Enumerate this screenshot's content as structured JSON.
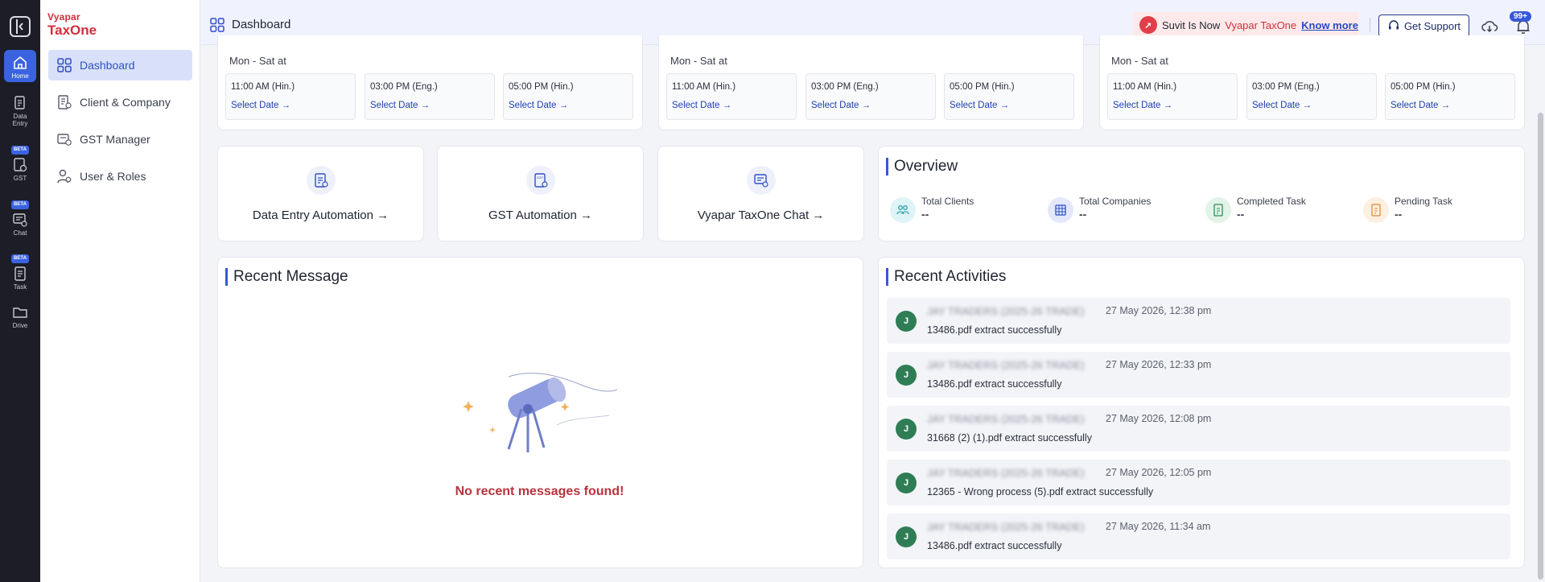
{
  "rail": {
    "items": [
      {
        "label": "Home",
        "icon": "home-icon"
      },
      {
        "label": "Data Entry",
        "icon": "data-entry-icon"
      },
      {
        "label": "GST",
        "icon": "gst-icon",
        "badge": "BETA"
      },
      {
        "label": "Chat",
        "icon": "chat-icon",
        "badge": "BETA"
      },
      {
        "label": "Task",
        "icon": "task-icon",
        "badge": "BETA"
      },
      {
        "label": "Drive",
        "icon": "folder-icon"
      }
    ]
  },
  "sidebar": {
    "logo_top": "Vyapar",
    "logo_main": "TaxOne",
    "items": [
      {
        "label": "Dashboard",
        "active": true
      },
      {
        "label": "Client & Company"
      },
      {
        "label": "GST Manager"
      },
      {
        "label": "User & Roles"
      }
    ]
  },
  "header": {
    "title": "Dashboard",
    "promo": {
      "text_a": "Suvit Is Now",
      "text_b": "Vyapar TaxOne",
      "link": "Know more"
    },
    "support_label": "Get Support",
    "notif_count": "99+"
  },
  "schedules": [
    {
      "label": "Mon - Sat at",
      "slots": [
        {
          "time": "11:00 AM (Hin.)",
          "link": "Select Date →"
        },
        {
          "time": "03:00 PM (Eng.)",
          "link": "Select Date →"
        },
        {
          "time": "05:00 PM (Hin.)",
          "link": "Select Date →"
        }
      ]
    },
    {
      "label": "Mon - Sat at",
      "slots": [
        {
          "time": "11:00 AM (Hin.)",
          "link": "Select Date →"
        },
        {
          "time": "03:00 PM (Eng.)",
          "link": "Select Date →"
        },
        {
          "time": "05:00 PM (Hin.)",
          "link": "Select Date →"
        }
      ]
    },
    {
      "label": "Mon - Sat at",
      "slots": [
        {
          "time": "11:00 AM (Hin.)",
          "link": "Select Date →"
        },
        {
          "time": "03:00 PM (Eng.)",
          "link": "Select Date →"
        },
        {
          "time": "05:00 PM (Hin.)",
          "link": "Select Date →"
        }
      ]
    }
  ],
  "automations": [
    {
      "label": "Data Entry Automation →",
      "icon": "data-entry-automation-icon"
    },
    {
      "label": "GST Automation →",
      "icon": "gst-automation-icon"
    },
    {
      "label": "Vyapar TaxOne Chat →",
      "icon": "chat-automation-icon"
    }
  ],
  "overview": {
    "title": "Overview",
    "items": [
      {
        "label": "Total Clients",
        "value": "--",
        "icon": "clients-icon",
        "color": "#dff4f6"
      },
      {
        "label": "Total Companies",
        "value": "--",
        "icon": "companies-icon",
        "color": "#e3e8fa"
      },
      {
        "label": "Completed Task",
        "value": "--",
        "icon": "completed-task-icon",
        "color": "#e2f3e8"
      },
      {
        "label": "Pending Task",
        "value": "--",
        "icon": "pending-task-icon",
        "color": "#fdf0e2"
      }
    ]
  },
  "recent_message": {
    "title": "Recent Message",
    "empty_text": "No recent messages found!"
  },
  "recent_activities": {
    "title": "Recent Activities",
    "items": [
      {
        "avatar": "J",
        "name": "JAY TRADERS (2025-26 TRADE)",
        "time": "27 May 2026, 12:38 pm",
        "desc": "13486.pdf extract successfully"
      },
      {
        "avatar": "J",
        "name": "JAY TRADERS (2025-26 TRADE)",
        "time": "27 May 2026, 12:33 pm",
        "desc": "13486.pdf extract successfully"
      },
      {
        "avatar": "J",
        "name": "JAY TRADERS (2025-26 TRADE)",
        "time": "27 May 2026, 12:08 pm",
        "desc": "31668 (2) (1).pdf extract successfully"
      },
      {
        "avatar": "J",
        "name": "JAY TRADERS (2025-26 TRADE)",
        "time": "27 May 2026, 12:05 pm",
        "desc": "12365 - Wrong process (5).pdf extract successfully"
      },
      {
        "avatar": "J",
        "name": "JAY TRADERS (2025-26 TRADE)",
        "time": "27 May 2026, 11:34 am",
        "desc": "13486.pdf extract successfully"
      }
    ]
  }
}
